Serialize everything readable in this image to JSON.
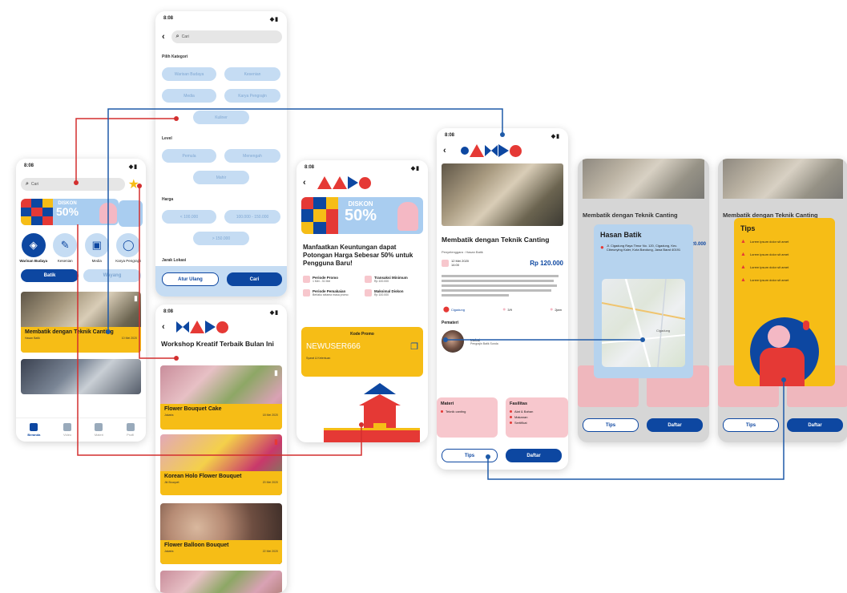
{
  "status_time": "8:08",
  "screen_home": {
    "search_placeholder": "Cari",
    "promo_label": "DISKON",
    "promo_value": "50%",
    "categories": [
      {
        "label": "Warisan Budaya",
        "icon": "batik-icon"
      },
      {
        "label": "Kesenian",
        "icon": "palette-icon"
      },
      {
        "label": "Media",
        "icon": "gift-icon"
      },
      {
        "label": "Karya Pengrajin",
        "icon": "bubble-icon"
      }
    ],
    "tab_batik": "Batik",
    "tab_wayang": "Wayang",
    "card_title": "Membatik dengan Teknik Canting",
    "card_author": "Hasan Batik",
    "card_date": "10 Mei 2020",
    "nav": [
      "Beranda",
      "Video",
      "Materi",
      "Profil"
    ]
  },
  "screen_filter": {
    "search_placeholder": "Cari",
    "section_kategori": "Pilih Kategori",
    "kategori_chips": [
      "Warisan Budaya",
      "Kesenian",
      "Media",
      "Karya Pengrajin",
      "Kuliner"
    ],
    "section_level": "Level",
    "level_chips": [
      "Pemula",
      "Menengah",
      "Mahir"
    ],
    "section_harga": "Harga",
    "harga_chips": [
      "< 100.000",
      "100.000 - 150.000",
      "> 150.000"
    ],
    "section_jarak": "Jarak Lokasi",
    "btn_reset": "Atur Ulang",
    "btn_search": "Cari"
  },
  "screen_workshop": {
    "heading": "Workshop Kreatif Terbaik Bulan Ini",
    "items": [
      {
        "title": "Flower Bouquet Cake",
        "author": "Jakarta",
        "date": "18 Mei 2020"
      },
      {
        "title": "Korean Holo Flower Bouquet",
        "author": "Jkt Bouquet",
        "date": "20 Mei 2020"
      },
      {
        "title": "Flower Balloon Bouquet",
        "author": "Jakarta",
        "date": "22 Mei 2020"
      }
    ]
  },
  "screen_promo": {
    "promo_label": "DISKON",
    "promo_value": "50%",
    "headline": "Manfaatkan Keuntungan dapat Potongan Harga Sebesar 50% untuk Pengguna Baru!",
    "info": [
      {
        "label": "Periode Promo",
        "value": "1 Mei - 31 Mei"
      },
      {
        "label": "Transaksi Minimum",
        "value": "Rp 100.000"
      },
      {
        "label": "Periode Pemakaian",
        "value": "Berlaku selama masa promo"
      },
      {
        "label": "Maksimal Diskon",
        "value": "Rp 100.000"
      }
    ],
    "kode_label": "Kode Promo",
    "kode": "NEWUSER666",
    "kode_note": "Syarat & Ketentuan"
  },
  "screen_detail": {
    "title": "Membatik dengan Teknik Canting",
    "penyelenggara": "Penyelenggara : Hasan Batik",
    "date": "12 Mei 2020",
    "time": "14:00",
    "price": "Rp 120.000",
    "location": "Cigadung",
    "participants": "3/9",
    "duration": "2jam",
    "pemateri_label": "Pemateri",
    "pemateri_name": "Melati",
    "pemateri_role": "Pengrajin Batik Sunda",
    "materi_label": "Materi",
    "materi_items": [
      "Teknik canting"
    ],
    "fasilitas_label": "Fasilitas",
    "fasilitas_items": [
      "Alat & Bahan",
      "Makanan",
      "Sertifikat"
    ],
    "btn_tips": "Tips",
    "btn_daftar": "Daftar"
  },
  "screen_map": {
    "card_title": "Hasan Batik",
    "address": "Jl. Cigadung Raya Timur No. 120, Cigadung, Kec. Cibeunying Kaler, Kota Bandung, Jawa Barat 40191",
    "map_label": "Cigadung",
    "bg_title": "Membatik dengan Teknik Canting",
    "bg_price": "Rp 120.000",
    "btn_tips": "Tips",
    "btn_daftar": "Daftar"
  },
  "screen_tips": {
    "card_title": "Tips",
    "tips": [
      "Lorem ipsum dolor sit amet",
      "Lorem ipsum dolor sit amet",
      "Lorem ipsum dolor sit amet",
      "Lorem ipsum dolor sit amet"
    ],
    "bg_title": "Membatik dengan Teknik Canting",
    "btn_tips": "Tips",
    "btn_daftar": "Daftar"
  },
  "colors": {
    "blue": "#0d47a1",
    "red": "#e53935",
    "yellow": "#f6bd16",
    "lightblue": "#a9cdf0",
    "pink": "#f7c7cd"
  }
}
